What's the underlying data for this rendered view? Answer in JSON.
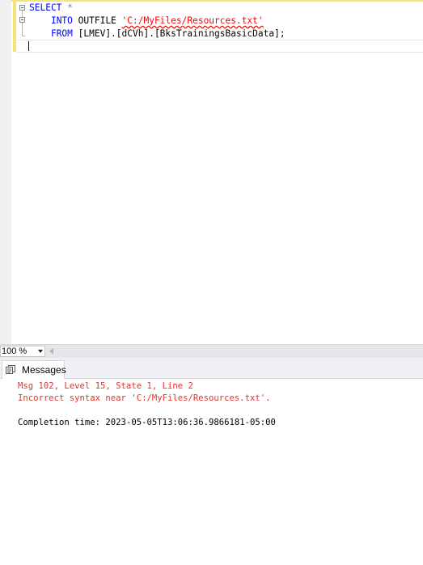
{
  "editor": {
    "lines": [
      {
        "kw1": "SELECT",
        "rest": " *"
      },
      {
        "kw1": "INTO",
        "mid": " OUTFILE ",
        "str": "'C:/MyFiles/Resources.txt'"
      },
      {
        "kw1": "FROM",
        "rest": " [LMEV].[dCVh].[BksTrainingsBasicData];"
      }
    ]
  },
  "zoom": {
    "value": "100 %"
  },
  "results": {
    "tab_label": "Messages",
    "messages": [
      "Msg 102, Level 15, State 1, Line 2",
      "Incorrect syntax near 'C:/MyFiles/Resources.txt'.",
      "Completion time: 2023-05-05T13:06:36.9866181-05:00"
    ]
  },
  "colors": {
    "keyword": "#0000ff",
    "string": "#ff0000",
    "error": "#e0342b",
    "change_bar": "#f5e27a"
  }
}
